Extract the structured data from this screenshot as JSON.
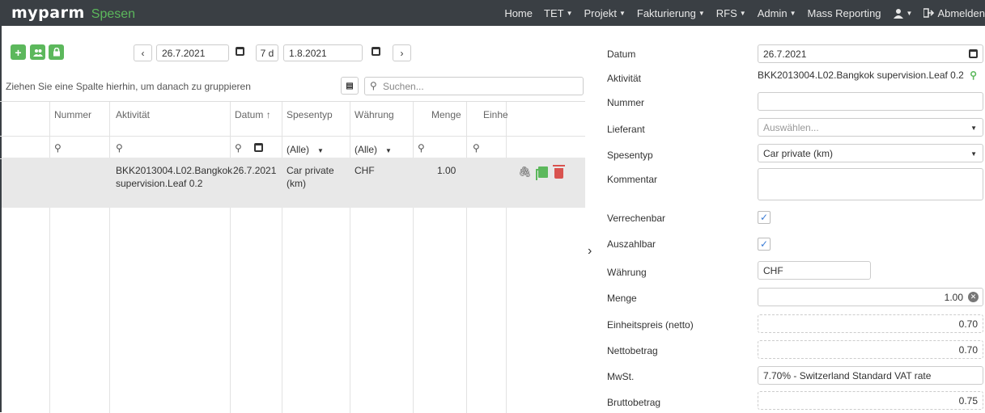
{
  "app": {
    "logo": "myparm",
    "module": "Spesen"
  },
  "nav": [
    {
      "label": "Home",
      "caret": false
    },
    {
      "label": "TET",
      "caret": true
    },
    {
      "label": "Projekt",
      "caret": true
    },
    {
      "label": "Fakturierung",
      "caret": true
    },
    {
      "label": "RFS",
      "caret": true
    },
    {
      "label": "Admin",
      "caret": true
    },
    {
      "label": "Mass Reporting",
      "caret": false
    }
  ],
  "nav_user_caret": "▾",
  "nav_logout": "Abmelden",
  "toolbar": {
    "add": "+",
    "date_from": "26.7.2021",
    "days": "7 d",
    "date_to": "1.8.2021",
    "prev": "‹",
    "next": "›"
  },
  "grid": {
    "group_hint": "Ziehen Sie eine Spalte hierhin, um danach zu gruppieren",
    "search_placeholder": "Suchen...",
    "columns": [
      "Nummer",
      "Aktivität",
      "Datum",
      "Spesentyp",
      "Währung",
      "Menge",
      "Einhe"
    ],
    "sort_indicator": "↑",
    "filter_all": "(Alle)",
    "rows": [
      {
        "nummer": "",
        "aktivitaet_line1": "BKK2013004.L02.Bangkok",
        "aktivitaet_line2": "supervision.Leaf 0.2",
        "datum": "26.7.2021",
        "spesentyp_line1": "Car private",
        "spesentyp_line2": "(km)",
        "waehrung": "CHF",
        "menge": "1.00"
      }
    ]
  },
  "form": {
    "datum_label": "Datum",
    "datum_value": "26.7.2021",
    "aktivitaet_label": "Aktivität",
    "aktivitaet_value": "BKK2013004.L02.Bangkok supervision.Leaf 0.2",
    "nummer_label": "Nummer",
    "nummer_value": "",
    "lieferant_label": "Lieferant",
    "lieferant_placeholder": "Auswählen...",
    "spesentyp_label": "Spesentyp",
    "spesentyp_value": "Car private (km)",
    "kommentar_label": "Kommentar",
    "kommentar_value": "",
    "verrechenbar_label": "Verrechenbar",
    "verrechenbar_checked": true,
    "auszahlbar_label": "Auszahlbar",
    "auszahlbar_checked": true,
    "waehrung_label": "Währung",
    "waehrung_value": "CHF",
    "menge_label": "Menge",
    "menge_value": "1.00",
    "einheitspreis_label": "Einheitspreis (netto)",
    "einheitspreis_value": "0.70",
    "nettobetrag_label": "Nettobetrag",
    "nettobetrag_value": "0.70",
    "mwst_label": "MwSt.",
    "mwst_value": "7.70% - Switzerland Standard VAT rate",
    "bruttobetrag_label": "Bruttobetrag",
    "bruttobetrag_value": "0.75"
  },
  "colors": {
    "topbar": "#3a3f44",
    "accent_green": "#5cb85c",
    "danger": "#d9534f"
  }
}
